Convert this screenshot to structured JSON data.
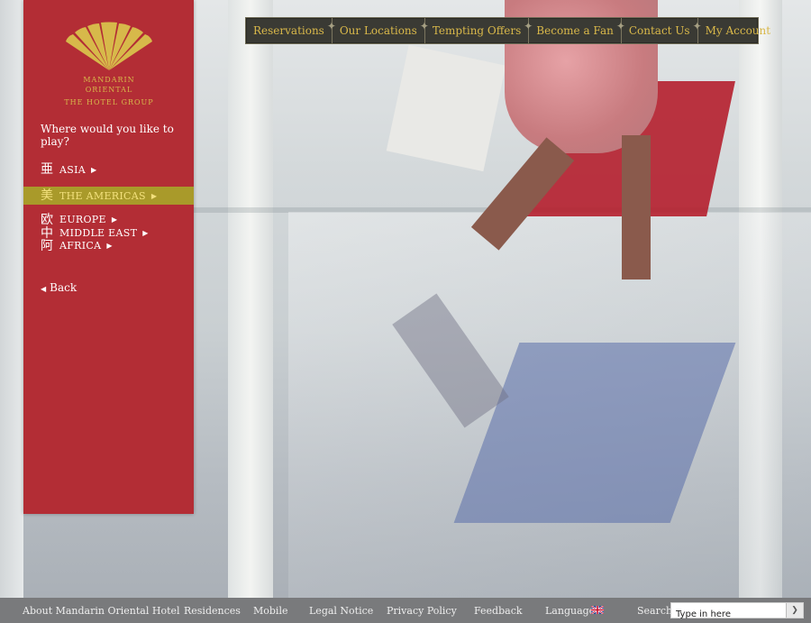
{
  "nav": {
    "items": [
      "Reservations",
      "Our Locations",
      "Tempting Offers",
      "Become a Fan",
      "Contact Us",
      "My Account"
    ]
  },
  "brand": {
    "line1": "MANDARIN ORIENTAL",
    "line2": "THE HOTEL GROUP",
    "color": "#d7b94a"
  },
  "panel": {
    "prompt": "Where would you like to play?",
    "regions": [
      {
        "glyph": "亜",
        "label": "ASIA",
        "active": false
      },
      {
        "glyph": "美",
        "label": "THE AMERICAS",
        "active": true
      },
      {
        "glyph": "欧",
        "label": "EUROPE",
        "active": false
      },
      {
        "glyph": "中",
        "label": "MIDDLE EAST",
        "active": false
      },
      {
        "glyph": "阿",
        "label": "AFRICA",
        "active": false
      }
    ],
    "back_label": "Back",
    "color": "#b32d35",
    "active_color": "#a99a2a"
  },
  "footer": {
    "links": [
      "About Mandarin Oriental Hotel",
      "Residences",
      "Mobile",
      "Legal Notice",
      "Privacy Policy",
      "Feedback"
    ],
    "language_label": "Language",
    "search_label": "Search",
    "search_value": "Type in here"
  }
}
